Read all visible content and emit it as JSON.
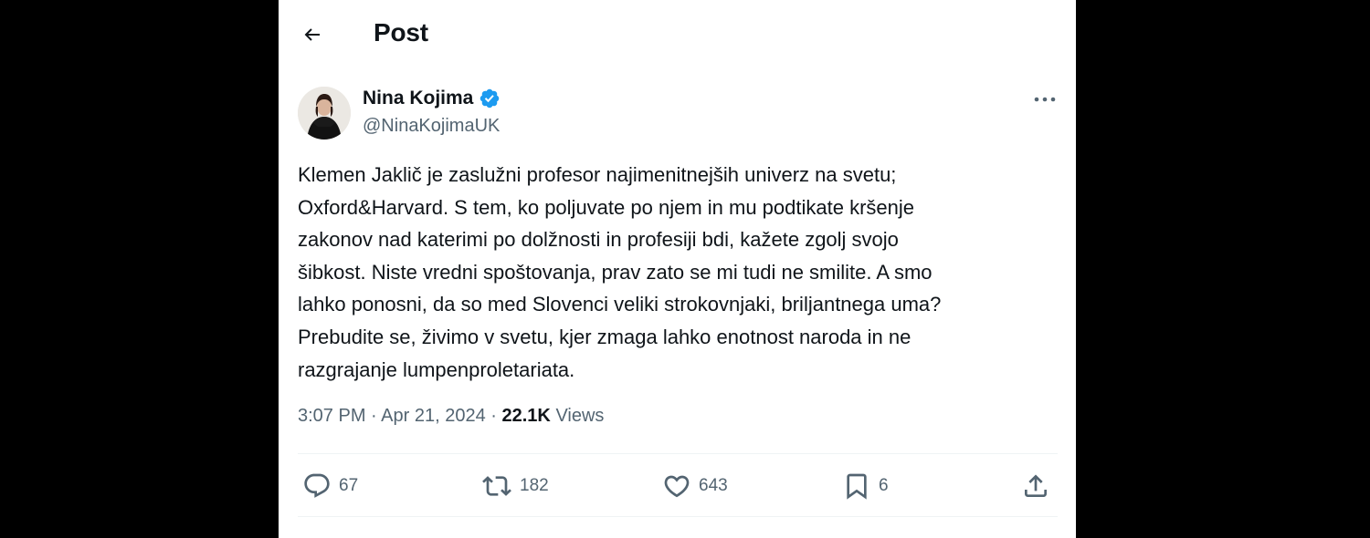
{
  "header": {
    "title": "Post",
    "back_icon": "back-arrow-icon"
  },
  "author": {
    "display_name": "Nina Kojima",
    "handle": "@NinaKojimaUK",
    "verified": true,
    "verified_color": "#1d9bf0"
  },
  "post": {
    "text_lines": [
      "Klemen Jaklič je zaslužni profesor najimenitnejših univerz na svetu;",
      "Oxford&Harvard. S tem, ko poljuvate po njem in mu podtikate kršenje",
      "zakonov nad katerimi po dolžnosti in profesiji bdi, kažete zgolj svojo",
      "šibkost. Niste vredni spoštovanja, prav zato se mi tudi ne smilite. A smo",
      "lahko ponosni, da so med Slovenci veliki strokovnjaki, briljantnega uma?",
      "Prebudite se, živimo v svetu, kjer zmaga lahko enotnost naroda in ne",
      "razgrajanje lumpenproletariata."
    ],
    "time": "3:07 PM",
    "date": "Apr 21, 2024",
    "separator": "·",
    "views_count": "22.1K",
    "views_label": "Views"
  },
  "actions": {
    "replies": "67",
    "reposts": "182",
    "likes": "643",
    "bookmarks": "6"
  },
  "colors": {
    "text_primary": "#0f1419",
    "text_secondary": "#536471",
    "divider": "#eff3f4",
    "background": "#ffffff",
    "frame": "#000000"
  }
}
